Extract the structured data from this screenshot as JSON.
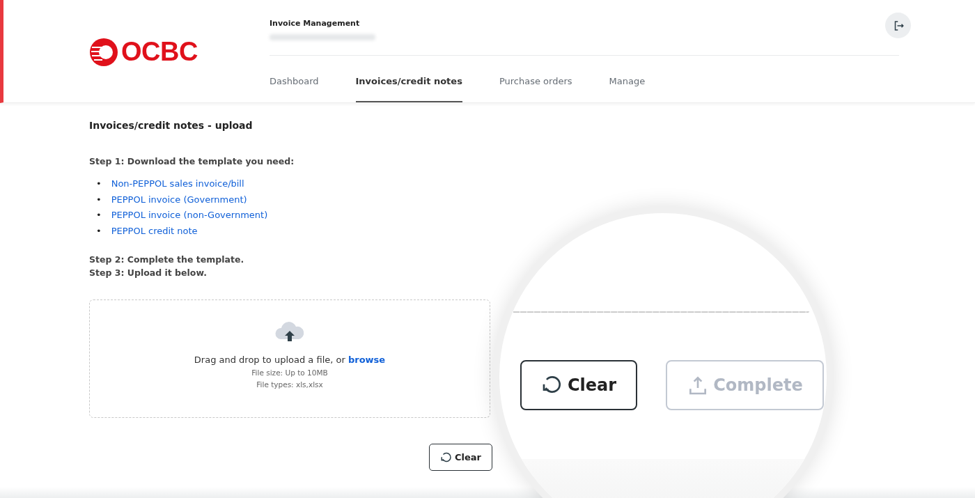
{
  "logo": {
    "text": "OCBC"
  },
  "header": {
    "title": "Invoice Management"
  },
  "tabs": [
    {
      "label": "Dashboard",
      "selected": false
    },
    {
      "label": "Invoices/credit notes",
      "selected": true
    },
    {
      "label": "Purchase orders",
      "selected": false
    },
    {
      "label": "Manage",
      "selected": false
    }
  ],
  "page": {
    "heading": "Invoices/credit notes - upload",
    "step1": "Step 1: Download the template you need:",
    "templates": [
      {
        "bullet": "•",
        "label": "Non-PEPPOL sales invoice/bill"
      },
      {
        "bullet": "•",
        "label": "PEPPOL invoice (Government)"
      },
      {
        "bullet": "•",
        "label": "PEPPOL invoice (non-Government)"
      },
      {
        "bullet": "•",
        "label": "PEPPOL credit note"
      }
    ],
    "step2": "Step 2: Complete the template.",
    "step3": "Step 3: Upload it below."
  },
  "upload": {
    "prompt": "Drag and drop to upload a file, or",
    "browse": "browse",
    "file_size": "File size: Up to 10MB",
    "file_types": "File types: xls,xlsx"
  },
  "buttons": [
    {
      "kind": "clear",
      "label": "Clear",
      "disabled": false
    }
  ],
  "magnifier": {
    "buttons": [
      {
        "kind": "clear",
        "label": "Clear",
        "disabled": false
      },
      {
        "kind": "complete",
        "label": "Complete",
        "disabled": true
      }
    ]
  }
}
